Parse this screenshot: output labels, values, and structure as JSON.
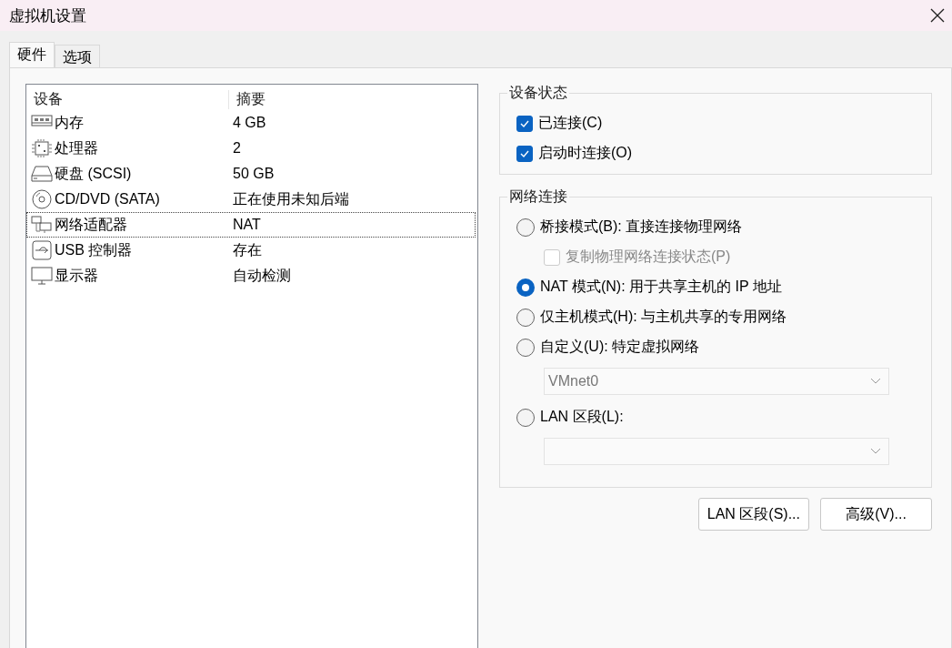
{
  "window": {
    "title": "虚拟机设置"
  },
  "tabs": [
    {
      "label": "硬件",
      "selected": true
    },
    {
      "label": "选项",
      "selected": false
    }
  ],
  "device_table": {
    "columns": [
      "设备",
      "摘要"
    ],
    "rows": [
      {
        "kind": "memory",
        "device": "内存",
        "summary": "4 GB",
        "selected": false
      },
      {
        "kind": "processor",
        "device": "处理器",
        "summary": "2",
        "selected": false
      },
      {
        "kind": "disk",
        "device": "硬盘 (SCSI)",
        "summary": "50 GB",
        "selected": false
      },
      {
        "kind": "disc",
        "device": "CD/DVD (SATA)",
        "summary": "正在使用未知后端",
        "selected": false
      },
      {
        "kind": "network",
        "device": "网络适配器",
        "summary": "NAT",
        "selected": true
      },
      {
        "kind": "usb",
        "device": "USB 控制器",
        "summary": "存在",
        "selected": false
      },
      {
        "kind": "display",
        "device": "显示器",
        "summary": "自动检测",
        "selected": false
      }
    ]
  },
  "device_status": {
    "title": "设备状态",
    "options": [
      {
        "label": "已连接(C)",
        "checked": true
      },
      {
        "label": "启动时连接(O)",
        "checked": true
      }
    ]
  },
  "network_connection": {
    "title": "网络连接",
    "items": [
      {
        "kind": "radio",
        "label": "桥接模式(B): 直接连接物理网络",
        "selected": false
      },
      {
        "kind": "checkbox",
        "label": "复制物理网络连接状态(P)",
        "checked": false,
        "disabled": true
      },
      {
        "kind": "radio",
        "label": "NAT 模式(N): 用于共享主机的 IP 地址",
        "selected": true
      },
      {
        "kind": "radio",
        "label": "仅主机模式(H): 与主机共享的专用网络",
        "selected": false
      },
      {
        "kind": "radio",
        "label": "自定义(U): 特定虚拟网络",
        "selected": false
      },
      {
        "kind": "select",
        "value": "VMnet0",
        "disabled": true
      },
      {
        "kind": "radio",
        "label": "LAN 区段(L):",
        "selected": false
      },
      {
        "kind": "select",
        "disabled": true
      }
    ]
  },
  "buttons": [
    "LAN 区段(S)...",
    "高级(V)..."
  ]
}
